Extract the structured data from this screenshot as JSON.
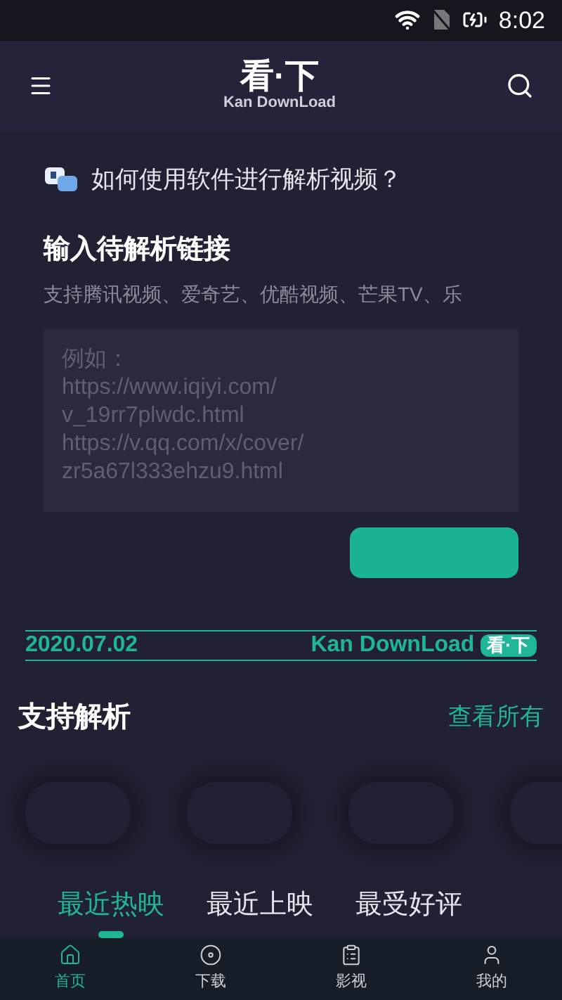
{
  "status_bar": {
    "time": "8:02"
  },
  "header": {
    "logo": "看·下",
    "logo_subtitle": "Kan DownLoad"
  },
  "help": {
    "text": "如何使用软件进行解析视频？"
  },
  "input_section": {
    "title": "输入待解析链接",
    "hint": "支持腾讯视频、爱奇艺、优酷视频、芒果TV、乐",
    "placeholder_lines": [
      "例如：",
      "https://www.iqiyi.com/",
      "v_19rr7plwdc.html",
      "https://v.qq.com/x/cover/",
      "zr5a67l333ehzu9.html"
    ]
  },
  "banner": {
    "date": "2020.07.02",
    "brand": "Kan DownLoad",
    "badge": "看·下"
  },
  "supported": {
    "title": "支持解析",
    "more": "查看所有"
  },
  "tabs": [
    {
      "label": "最近热映",
      "selected": true
    },
    {
      "label": "最近上映",
      "selected": false
    },
    {
      "label": "最受好评",
      "selected": false
    }
  ],
  "bottom_nav": [
    {
      "label": "首页",
      "selected": true
    },
    {
      "label": "下载",
      "selected": false
    },
    {
      "label": "影视",
      "selected": false
    },
    {
      "label": "我的",
      "selected": false
    }
  ]
}
